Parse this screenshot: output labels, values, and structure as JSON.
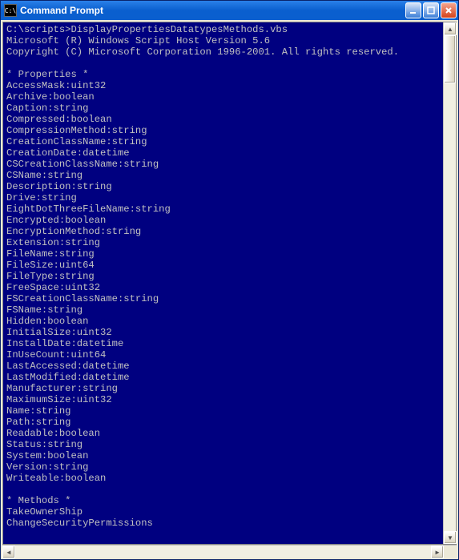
{
  "window": {
    "icon_text": "C:\\",
    "title": "Command Prompt"
  },
  "console": {
    "prompt_line": "C:\\scripts>DisplayPropertiesDatatypesMethods.vbs",
    "header_lines": [
      "Microsoft (R) Windows Script Host Version 5.6",
      "Copyright (C) Microsoft Corporation 1996-2001. All rights reserved."
    ],
    "properties_header": "* Properties *",
    "properties": [
      "AccessMask:uint32",
      "Archive:boolean",
      "Caption:string",
      "Compressed:boolean",
      "CompressionMethod:string",
      "CreationClassName:string",
      "CreationDate:datetime",
      "CSCreationClassName:string",
      "CSName:string",
      "Description:string",
      "Drive:string",
      "EightDotThreeFileName:string",
      "Encrypted:boolean",
      "EncryptionMethod:string",
      "Extension:string",
      "FileName:string",
      "FileSize:uint64",
      "FileType:string",
      "FreeSpace:uint32",
      "FSCreationClassName:string",
      "FSName:string",
      "Hidden:boolean",
      "InitialSize:uint32",
      "InstallDate:datetime",
      "InUseCount:uint64",
      "LastAccessed:datetime",
      "LastModified:datetime",
      "Manufacturer:string",
      "MaximumSize:uint32",
      "Name:string",
      "Path:string",
      "Readable:boolean",
      "Status:string",
      "System:boolean",
      "Version:string",
      "Writeable:boolean"
    ],
    "methods_header": "* Methods *",
    "methods": [
      "TakeOwnerShip",
      "ChangeSecurityPermissions"
    ]
  }
}
